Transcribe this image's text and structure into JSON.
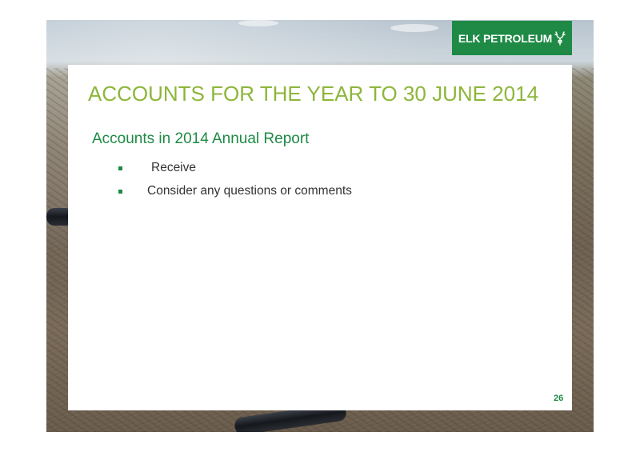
{
  "logo": {
    "text": "ELK PETROLEUM",
    "icon": "elk-antler-icon",
    "background": "#1e8a45"
  },
  "slide": {
    "title": "ACCOUNTS FOR THE YEAR TO 30 JUNE 2014",
    "subtitle": "Accounts in 2014 Annual Report",
    "bullets": [
      {
        "icon": "square-bullet-icon",
        "text": "Receive"
      },
      {
        "icon": "square-bullet-icon",
        "text": "Consider any questions or comments"
      }
    ],
    "page_number": "26"
  },
  "colors": {
    "title": "#8db63a",
    "accent": "#1e8a45"
  }
}
